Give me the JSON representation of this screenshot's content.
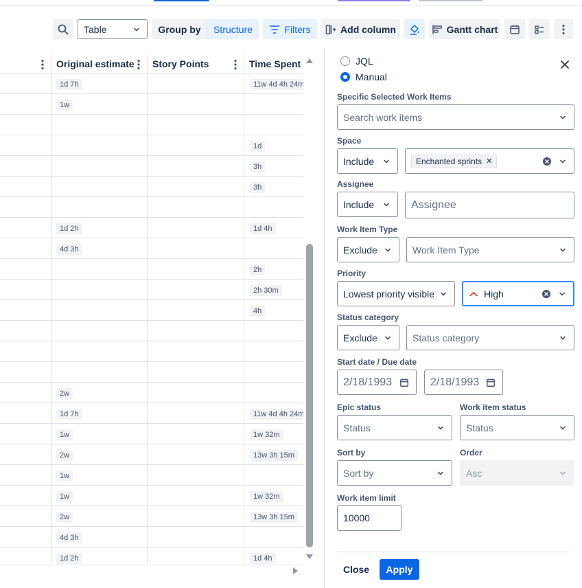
{
  "colors": {
    "accent": "#0c66e4",
    "accent_bg": "#e9f2ff",
    "border": "#dfe1e6",
    "priority_high": "#c9372c"
  },
  "toolbar": {
    "view_select": "Table",
    "group_by_label": "Group by",
    "group_by_value": "Structure",
    "filters_label": "Filters",
    "add_column_label": "Add column",
    "gantt_label": "Gantt chart"
  },
  "table": {
    "columns": [
      "Original estimate",
      "Story Points",
      "Time Spent"
    ],
    "rows": [
      {
        "estimate": "1d 7h",
        "spent": "11w 4d 4h 24m"
      },
      {
        "estimate": "1w",
        "spent": ""
      },
      {
        "estimate": "",
        "spent": ""
      },
      {
        "estimate": "",
        "spent": "1d"
      },
      {
        "estimate": "",
        "spent": "3h"
      },
      {
        "estimate": "",
        "spent": "3h"
      },
      {
        "estimate": "",
        "spent": ""
      },
      {
        "estimate": "1d 2h",
        "spent": "1d 4h"
      },
      {
        "estimate": "4d 3h",
        "spent": ""
      },
      {
        "estimate": "",
        "spent": "2h"
      },
      {
        "estimate": "",
        "spent": "2h 30m"
      },
      {
        "estimate": "",
        "spent": "4h"
      },
      {
        "estimate": "",
        "spent": ""
      },
      {
        "estimate": "",
        "spent": ""
      },
      {
        "estimate": "",
        "spent": ""
      },
      {
        "estimate": "2w",
        "spent": ""
      },
      {
        "estimate": "1d 7h",
        "spent": "11w 4d 4h 24m"
      },
      {
        "estimate": "1w",
        "spent": "1w 32m"
      },
      {
        "estimate": "2w",
        "spent": "13w 3h 15m"
      },
      {
        "estimate": "1w",
        "spent": ""
      },
      {
        "estimate": "1w",
        "spent": "1w 32m"
      },
      {
        "estimate": "2w",
        "spent": "13w 3h 15m"
      },
      {
        "estimate": "4d 3h",
        "spent": ""
      },
      {
        "estimate": "1d 2h",
        "spent": "1d 4h"
      }
    ]
  },
  "panel": {
    "mode_jql": "JQL",
    "mode_manual": "Manual",
    "mode_selected": "Manual",
    "specific_label": "Specific Selected Work Items",
    "specific_placeholder": "Search work items",
    "space_label": "Space",
    "space_op": "Include",
    "space_tag": "Enchanted sprints",
    "assignee_label": "Assignee",
    "assignee_op": "Include",
    "assignee_placeholder": "Assignee",
    "type_label": "Work Item Type",
    "type_op": "Exclude",
    "type_placeholder": "Work Item Type",
    "priority_label": "Priority",
    "priority_op": "Lowest priority visible",
    "priority_value": "High",
    "status_cat_label": "Status category",
    "status_cat_op": "Exclude",
    "status_cat_placeholder": "Status category",
    "date_label": "Start date / Due date",
    "start_date": "2/18/1993",
    "due_date": "2/18/1993",
    "epic_status_label": "Epic status",
    "epic_status_placeholder": "Status",
    "work_status_label": "Work item status",
    "work_status_placeholder": "Status",
    "sort_label": "Sort by",
    "sort_placeholder": "Sort by",
    "order_label": "Order",
    "order_value": "Asc",
    "limit_label": "Work item limit",
    "limit_value": "10000",
    "close_label": "Close",
    "apply_label": "Apply"
  }
}
